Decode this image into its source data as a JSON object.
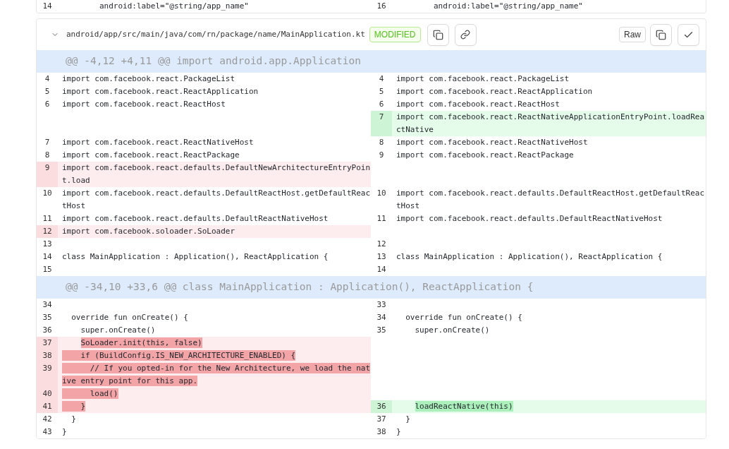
{
  "previous_file": {
    "rows": [
      {
        "left": {
          "kind": "context",
          "number": "14",
          "text": "        android:label=\"@string/app_name\""
        },
        "right": {
          "kind": "context",
          "number": "16",
          "text": "        android:label=\"@string/app_name\""
        }
      }
    ]
  },
  "file": {
    "expanded": true,
    "path": "android/app/src/main/java/com/rn/package/name/MainApplication.kt",
    "status": {
      "kind": "modified",
      "label": "MODIFIED"
    },
    "raw_button": "Raw"
  },
  "hunks": [
    {
      "header": "@@ -4,12 +4,11 @@ import android.app.Application",
      "rows": [
        {
          "left": {
            "kind": "context",
            "number": "4",
            "text": "import com.facebook.react.PackageList"
          },
          "right": {
            "kind": "context",
            "number": "4",
            "text": "import com.facebook.react.PackageList"
          }
        },
        {
          "left": {
            "kind": "context",
            "number": "5",
            "text": "import com.facebook.react.ReactApplication"
          },
          "right": {
            "kind": "context",
            "number": "5",
            "text": "import com.facebook.react.ReactApplication"
          }
        },
        {
          "left": {
            "kind": "context",
            "number": "6",
            "text": "import com.facebook.react.ReactHost"
          },
          "right": {
            "kind": "context",
            "number": "6",
            "text": "import com.facebook.react.ReactHost"
          }
        },
        {
          "right": {
            "kind": "added",
            "number": "7",
            "text": "import com.facebook.react.ReactNativeApplicationEntryPoint.loadReactNative",
            "highlighted": false
          }
        },
        {
          "left": {
            "kind": "context",
            "number": "7",
            "text": "import com.facebook.react.ReactNativeHost"
          },
          "right": {
            "kind": "context",
            "number": "8",
            "text": "import com.facebook.react.ReactNativeHost"
          }
        },
        {
          "left": {
            "kind": "context",
            "number": "8",
            "text": "import com.facebook.react.ReactPackage"
          },
          "right": {
            "kind": "context",
            "number": "9",
            "text": "import com.facebook.react.ReactPackage"
          }
        },
        {
          "left": {
            "kind": "removed",
            "number": "9",
            "text": "import com.facebook.react.defaults.DefaultNewArchitectureEntryPoint.load",
            "highlighted": false
          }
        },
        {
          "left": {
            "kind": "context",
            "number": "10",
            "text": "import com.facebook.react.defaults.DefaultReactHost.getDefaultReactHost"
          },
          "right": {
            "kind": "context",
            "number": "10",
            "text": "import com.facebook.react.defaults.DefaultReactHost.getDefaultReactHost"
          }
        },
        {
          "left": {
            "kind": "context",
            "number": "11",
            "text": "import com.facebook.react.defaults.DefaultReactNativeHost"
          },
          "right": {
            "kind": "context",
            "number": "11",
            "text": "import com.facebook.react.defaults.DefaultReactNativeHost"
          }
        },
        {
          "left": {
            "kind": "removed",
            "number": "12",
            "text": "import com.facebook.soloader.SoLoader",
            "highlighted": false
          }
        },
        {
          "left": {
            "kind": "context",
            "number": "13"
          },
          "right": {
            "kind": "context",
            "number": "12"
          }
        },
        {
          "left": {
            "kind": "context",
            "number": "14",
            "text": "class MainApplication : Application(), ReactApplication {"
          },
          "right": {
            "kind": "context",
            "number": "13",
            "text": "class MainApplication : Application(), ReactApplication {"
          }
        },
        {
          "left": {
            "kind": "context",
            "number": "15"
          },
          "right": {
            "kind": "context",
            "number": "14"
          }
        }
      ]
    },
    {
      "header": "@@ -34,10 +33,6 @@ class MainApplication : Application(), ReactApplication {",
      "rows": [
        {
          "left": {
            "kind": "context",
            "number": "34"
          },
          "right": {
            "kind": "context",
            "number": "33"
          }
        },
        {
          "left": {
            "kind": "context",
            "number": "35",
            "text": "  override fun onCreate() {"
          },
          "right": {
            "kind": "context",
            "number": "34",
            "text": "  override fun onCreate() {"
          }
        },
        {
          "left": {
            "kind": "context",
            "number": "36",
            "text": "    super.onCreate()"
          },
          "right": {
            "kind": "context",
            "number": "35",
            "text": "    super.onCreate()"
          }
        },
        {
          "left": {
            "kind": "removed",
            "number": "37",
            "text": "    SoLoader.init(this, false)",
            "highlighted": true,
            "indent_highlighted": false
          }
        },
        {
          "left": {
            "kind": "removed",
            "number": "38",
            "text": "    if (BuildConfig.IS_NEW_ARCHITECTURE_ENABLED) {",
            "highlighted": true,
            "indent_highlighted": true
          }
        },
        {
          "left": {
            "kind": "removed",
            "number": "39",
            "text": "      // If you opted-in for the New Architecture, we load the native entry point for this app.",
            "highlighted": true,
            "indent_highlighted": true
          }
        },
        {
          "left": {
            "kind": "removed",
            "number": "40",
            "text": "      load()",
            "highlighted": true,
            "indent_highlighted": true
          }
        },
        {
          "left": {
            "kind": "removed",
            "number": "41",
            "text": "    }",
            "highlighted": true,
            "indent_highlighted": true
          },
          "right": {
            "kind": "added",
            "number": "36",
            "text": "    loadReactNative(this)",
            "highlighted": true,
            "indent_highlighted": false
          }
        },
        {
          "left": {
            "kind": "context",
            "number": "42",
            "text": "  }"
          },
          "right": {
            "kind": "context",
            "number": "37",
            "text": "  }"
          }
        },
        {
          "left": {
            "kind": "context",
            "number": "43",
            "text": "}"
          },
          "right": {
            "kind": "context",
            "number": "38",
            "text": "}"
          }
        }
      ]
    }
  ]
}
